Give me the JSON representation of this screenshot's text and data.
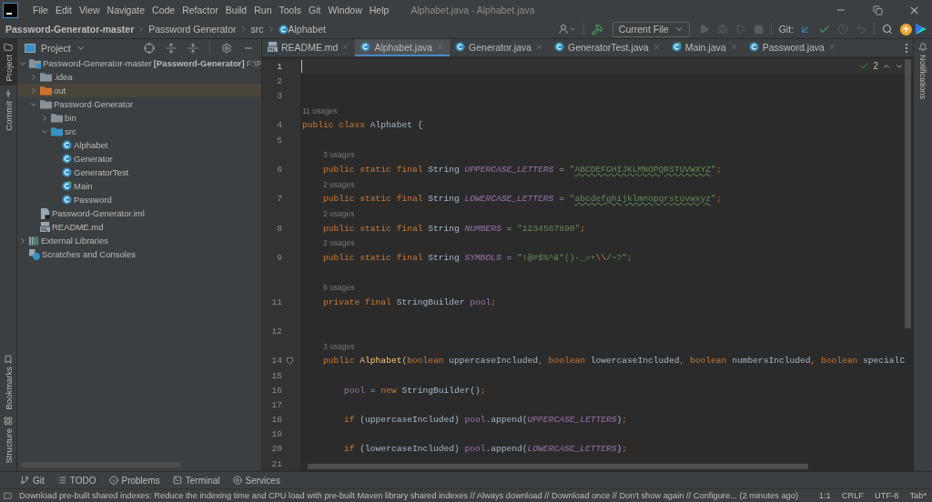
{
  "menu_bar": {
    "items": [
      "File",
      "Edit",
      "View",
      "Navigate",
      "Code",
      "Refactor",
      "Build",
      "Run",
      "Tools",
      "Git",
      "Window",
      "Help"
    ],
    "title": "Alphabet.java - Alphabet.java"
  },
  "navigation_bar": {
    "breadcrumbs": [
      {
        "label": "Password-Generator-master",
        "kind": "project"
      },
      {
        "label": "Password Generator",
        "kind": "folder"
      },
      {
        "label": "src",
        "kind": "folder"
      },
      {
        "label": "Alphabet",
        "kind": "class"
      }
    ],
    "run_config": "Current File",
    "vcs_label": "Git:"
  },
  "left_strip": {
    "top": [
      {
        "label": "Project",
        "kind": "project",
        "selected": true
      },
      {
        "label": "Commit",
        "kind": "commit",
        "selected": false
      }
    ],
    "bottom": [
      {
        "label": "Bookmarks",
        "kind": "bookmarks",
        "selected": false
      },
      {
        "label": "Structure",
        "kind": "structure",
        "selected": false
      }
    ]
  },
  "project_panel": {
    "title": "Project",
    "tree": [
      {
        "label": "Password-Generator-master",
        "suffix": "[Password-Generator]",
        "path": "F:\\P",
        "kind": "module",
        "expanded": true,
        "children": [
          {
            "label": ".idea",
            "kind": "folder",
            "expanded": false
          },
          {
            "label": "out",
            "kind": "excluded",
            "expanded": false
          },
          {
            "label": "Password Generator",
            "kind": "folder",
            "expanded": true,
            "children": [
              {
                "label": "bin",
                "kind": "folder",
                "expanded": false
              },
              {
                "label": "src",
                "kind": "source",
                "expanded": true,
                "children": [
                  {
                    "label": "Alphabet",
                    "kind": "class"
                  },
                  {
                    "label": "Generator",
                    "kind": "class"
                  },
                  {
                    "label": "GeneratorTest",
                    "kind": "class"
                  },
                  {
                    "label": "Main",
                    "kind": "main"
                  },
                  {
                    "label": "Password",
                    "kind": "class"
                  }
                ]
              }
            ]
          },
          {
            "label": "Password-Generator.iml",
            "kind": "iml"
          },
          {
            "label": "README.md",
            "kind": "md"
          }
        ]
      },
      {
        "label": "External Libraries",
        "kind": "libraries",
        "expanded": false
      },
      {
        "label": "Scratches and Consoles",
        "kind": "scratches"
      }
    ]
  },
  "editor": {
    "tabs": [
      {
        "label": "README.md",
        "kind": "md",
        "selected": false
      },
      {
        "label": "Alphabet.java",
        "kind": "class",
        "selected": true
      },
      {
        "label": "Generator.java",
        "kind": "class",
        "selected": false
      },
      {
        "label": "GeneratorTest.java",
        "kind": "class",
        "selected": false
      },
      {
        "label": "Main.java",
        "kind": "main",
        "selected": false
      },
      {
        "label": "Password.java",
        "kind": "class",
        "selected": false
      }
    ],
    "inspection_count": "2",
    "rows": [
      {
        "number": "1",
        "current": true
      },
      {
        "number": "2"
      },
      {
        "number": "3"
      },
      {
        "hint": "11 usages"
      },
      {
        "number": "4",
        "tokens": [
          {
            "kind": "kw",
            "text": "public class "
          },
          {
            "kind": "plain",
            "text": "Alphabet {"
          }
        ]
      },
      {
        "number": "5"
      },
      {
        "hint": "3 usages"
      },
      {
        "number": "6",
        "tokens": [
          {
            "kind": "kw",
            "text": "    public static final "
          },
          {
            "kind": "plain",
            "text": "String "
          },
          {
            "kind": "constant",
            "text": "UPPERCASE_LETTERS"
          },
          {
            "kind": "plain",
            "text": " = "
          },
          {
            "kind": "str",
            "text": "\""
          },
          {
            "kind": "typo",
            "text": "ABCDEFGHIJKLMNOPQRSTUVWXYZ"
          },
          {
            "kind": "str",
            "text": "\""
          },
          {
            "kind": "kw",
            "text": ";"
          }
        ]
      },
      {
        "hint": "2 usages"
      },
      {
        "number": "7",
        "tokens": [
          {
            "kind": "kw",
            "text": "    public static final "
          },
          {
            "kind": "plain",
            "text": "String "
          },
          {
            "kind": "constant",
            "text": "LOWERCASE_LETTERS"
          },
          {
            "kind": "plain",
            "text": " = "
          },
          {
            "kind": "str",
            "text": "\""
          },
          {
            "kind": "typo",
            "text": "abcdefghijklmnopqrstuvwxyz"
          },
          {
            "kind": "str",
            "text": "\""
          },
          {
            "kind": "kw",
            "text": ";"
          }
        ]
      },
      {
        "hint": "2 usages"
      },
      {
        "number": "8",
        "tokens": [
          {
            "kind": "kw",
            "text": "    public static final "
          },
          {
            "kind": "plain",
            "text": "String "
          },
          {
            "kind": "constant",
            "text": "NUMBERS"
          },
          {
            "kind": "plain",
            "text": " = "
          },
          {
            "kind": "str",
            "text": "\"1234567890\""
          },
          {
            "kind": "kw",
            "text": ";"
          }
        ]
      },
      {
        "hint": "2 usages"
      },
      {
        "number": "9",
        "tokens": [
          {
            "kind": "kw",
            "text": "    public static final "
          },
          {
            "kind": "plain",
            "text": "String "
          },
          {
            "kind": "constant",
            "text": "SYMBOLS"
          },
          {
            "kind": "plain",
            "text": " = "
          },
          {
            "kind": "str",
            "text": "\"!@#$%^&*()-_=+"
          },
          {
            "kind": "kw",
            "text": "\\\\"
          },
          {
            "kind": "str",
            "text": "/~?\""
          },
          {
            "kind": "kw",
            "text": ";"
          }
        ]
      },
      {},
      {
        "hint": "6 usages"
      },
      {
        "number": "11",
        "tokens": [
          {
            "kind": "kw",
            "text": "    private final "
          },
          {
            "kind": "plain",
            "text": "StringBuilder "
          },
          {
            "kind": "field",
            "text": "pool"
          },
          {
            "kind": "kw",
            "text": ";"
          }
        ]
      },
      {},
      {
        "number": "12"
      },
      {
        "hint": "3 usages"
      },
      {
        "number": "14",
        "fold": true,
        "tokens": [
          {
            "kind": "kw",
            "text": "    public "
          },
          {
            "kind": "fn",
            "text": "Alphabet"
          },
          {
            "kind": "plain",
            "text": "("
          },
          {
            "kind": "kw",
            "text": "boolean "
          },
          {
            "kind": "plain",
            "text": "uppercaseIncluded"
          },
          {
            "kind": "kw",
            "text": ", boolean "
          },
          {
            "kind": "plain",
            "text": "lowercaseIncluded"
          },
          {
            "kind": "kw",
            "text": ", boolean "
          },
          {
            "kind": "plain",
            "text": "numbersIncluded"
          },
          {
            "kind": "kw",
            "text": ", boolean "
          },
          {
            "kind": "plain",
            "text": "specialC"
          }
        ]
      },
      {
        "number": "15"
      },
      {
        "number": "16",
        "tokens": [
          {
            "kind": "field",
            "text": "        pool"
          },
          {
            "kind": "plain",
            "text": " = "
          },
          {
            "kind": "kw",
            "text": "new "
          },
          {
            "kind": "plain",
            "text": "StringBuilder()"
          },
          {
            "kind": "kw",
            "text": ";"
          }
        ]
      },
      {
        "number": "17"
      },
      {
        "number": "18",
        "tokens": [
          {
            "kind": "kw",
            "text": "        if "
          },
          {
            "kind": "plain",
            "text": "(uppercaseIncluded) "
          },
          {
            "kind": "field",
            "text": "pool"
          },
          {
            "kind": "plain",
            "text": ".append("
          },
          {
            "kind": "constant",
            "text": "UPPERCASE_LETTERS"
          },
          {
            "kind": "plain",
            "text": ")"
          },
          {
            "kind": "kw",
            "text": ";"
          }
        ]
      },
      {
        "number": "19"
      },
      {
        "number": "20",
        "tokens": [
          {
            "kind": "kw",
            "text": "        if "
          },
          {
            "kind": "plain",
            "text": "(lowercaseIncluded) "
          },
          {
            "kind": "field",
            "text": "pool"
          },
          {
            "kind": "plain",
            "text": ".append("
          },
          {
            "kind": "constant",
            "text": "LOWERCASE_LETTERS"
          },
          {
            "kind": "plain",
            "text": ")"
          },
          {
            "kind": "kw",
            "text": ";"
          }
        ]
      },
      {
        "number": "21"
      }
    ]
  },
  "right_strip": {
    "label": "Notifications"
  },
  "tool_window_bar": [
    {
      "label": "Git",
      "kind": "git"
    },
    {
      "label": "TODO",
      "kind": "todo"
    },
    {
      "label": "Problems",
      "kind": "problems"
    },
    {
      "label": "Terminal",
      "kind": "terminal"
    },
    {
      "label": "Services",
      "kind": "services"
    }
  ],
  "status_bar": {
    "message": "Download pre-built shared indexes: Reduce the indexing time and CPU load with pre-built Maven library shared indexes // Always download // Download once // Don't show again // Configure... (2 minutes ago)",
    "items": [
      "1:1",
      "CRLF",
      "UTF-8",
      "Tab*"
    ]
  }
}
